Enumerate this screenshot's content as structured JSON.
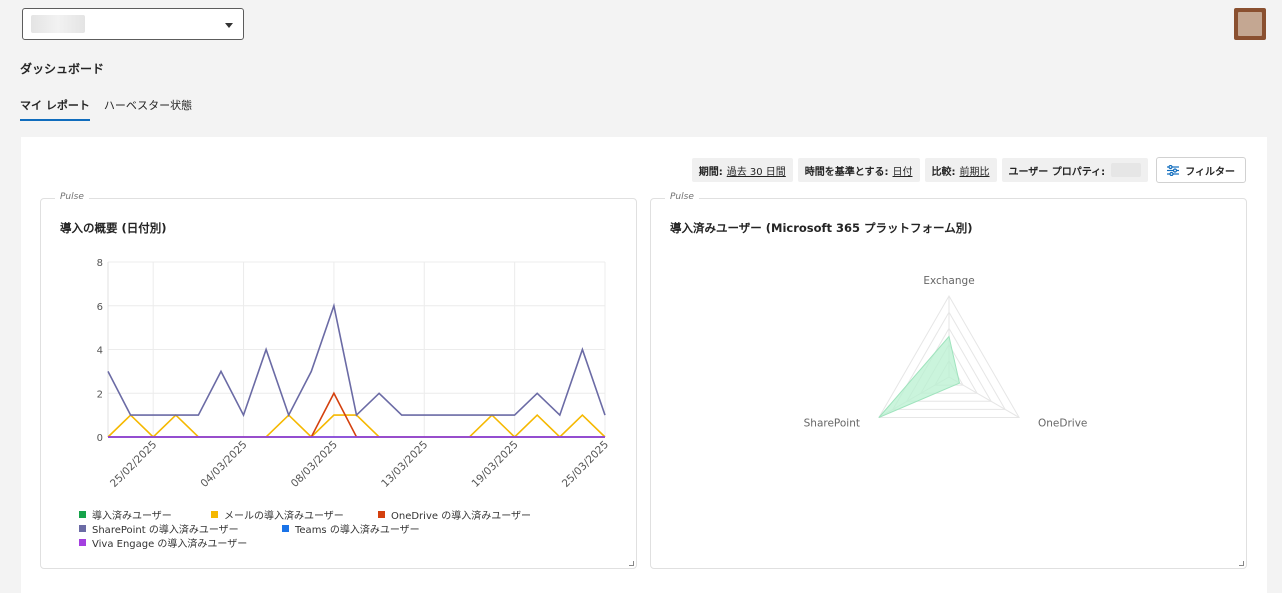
{
  "header": {
    "tenant_selector": "",
    "page_title": "ダッシュボード"
  },
  "tabs": [
    {
      "label": "マイ レポート",
      "active": true
    },
    {
      "label": "ハーベスター状態",
      "active": false
    }
  ],
  "filters": {
    "period_label": "期間:",
    "period_value": "過去 30 日間",
    "basis_label": "時間を基準とする:",
    "basis_value": "日付",
    "compare_label": "比較:",
    "compare_value": "前期比",
    "user_prop_label": "ユーザー プロパティ:",
    "filter_button": "フィルター"
  },
  "cards": {
    "left": {
      "tag": "Pulse",
      "title": "導入の概要 (日付別)"
    },
    "right": {
      "tag": "Pulse",
      "title": "導入済みユーザー (Microsoft 365 プラットフォーム別)"
    }
  },
  "colors": {
    "accent": "#0f6cbd",
    "series_green": "#16a34a",
    "series_yellow": "#f5b800",
    "series_orange": "#d4400e",
    "series_purple_gray": "#6b6ba5",
    "series_blue": "#1a73e8",
    "series_violet": "#a43fe0",
    "radar_fill": "#b8f0d0"
  },
  "chart_data": [
    {
      "type": "line",
      "y_ticks": [
        "0",
        "2",
        "4",
        "6",
        "8"
      ],
      "ylim": [
        0,
        8
      ],
      "x_count": 23,
      "x_tick_labels": [
        {
          "index": 2,
          "label": "25/02/2025"
        },
        {
          "index": 6,
          "label": "04/03/2025"
        },
        {
          "index": 10,
          "label": "08/03/2025"
        },
        {
          "index": 14,
          "label": "13/03/2025"
        },
        {
          "index": 18,
          "label": "19/03/2025"
        },
        {
          "index": 22,
          "label": "25/03/2025"
        }
      ],
      "grid": true,
      "legend_position": "bottom",
      "series": [
        {
          "name": "導入済みユーザー",
          "color": "#16a34a",
          "values": [
            0,
            0,
            0,
            0,
            0,
            0,
            0,
            0,
            0,
            0,
            0,
            0,
            0,
            0,
            0,
            0,
            0,
            0,
            0,
            0,
            0,
            0,
            0
          ]
        },
        {
          "name": "メールの導入済みユーザー",
          "color": "#f5b800",
          "values": [
            0,
            1,
            0,
            1,
            0,
            0,
            0,
            0,
            1,
            0,
            1,
            1,
            0,
            0,
            0,
            0,
            0,
            1,
            0,
            1,
            0,
            1,
            0
          ]
        },
        {
          "name": "OneDrive の導入済みユーザー",
          "color": "#d4400e",
          "values": [
            0,
            0,
            0,
            0,
            0,
            0,
            0,
            0,
            0,
            0,
            2,
            0,
            0,
            0,
            0,
            0,
            0,
            0,
            0,
            0,
            0,
            0,
            0
          ]
        },
        {
          "name": "SharePoint の導入済みユーザー",
          "color": "#6b6ba5",
          "values": [
            3,
            1,
            1,
            1,
            1,
            3,
            1,
            4,
            1,
            3,
            6,
            1,
            2,
            1,
            1,
            1,
            1,
            1,
            1,
            2,
            1,
            4,
            1
          ]
        },
        {
          "name": "Teams の導入済みユーザー",
          "color": "#1a73e8",
          "values": [
            0,
            0,
            0,
            0,
            0,
            0,
            0,
            0,
            0,
            0,
            0,
            0,
            0,
            0,
            0,
            0,
            0,
            0,
            0,
            0,
            0,
            0,
            0
          ]
        },
        {
          "name": "Viva Engage の導入済みユーザー",
          "color": "#a43fe0",
          "values": [
            0,
            0,
            0,
            0,
            0,
            0,
            0,
            0,
            0,
            0,
            0,
            0,
            0,
            0,
            0,
            0,
            0,
            0,
            0,
            0,
            0,
            0,
            0
          ]
        }
      ]
    },
    {
      "type": "radar",
      "axes": [
        "Exchange",
        "OneDrive",
        "SharePoint"
      ],
      "values": [
        0.5,
        0.15,
        1.0
      ],
      "max": 1.0,
      "rings": 5
    }
  ]
}
